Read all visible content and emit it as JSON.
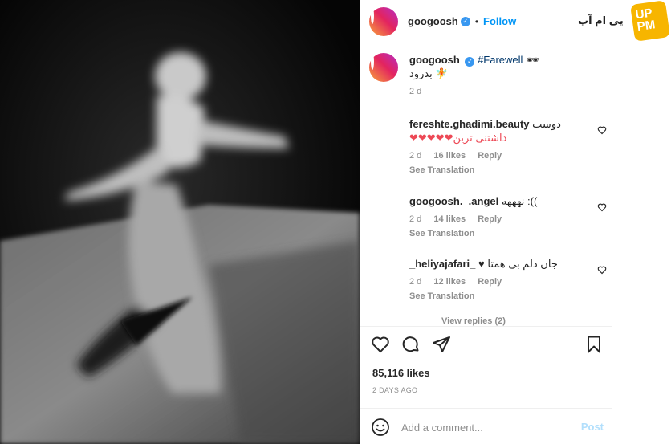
{
  "post": {
    "author": "googoosh",
    "follow_label": "Follow",
    "dot": "•",
    "caption_tag": "#Farewell",
    "caption_emoji": "🕶",
    "caption_line2": "بدرود 🧚",
    "caption_time": "2 d"
  },
  "comments": [
    {
      "username": "fereshte.ghadimi.beauty",
      "text_line1": "دوست",
      "text_line2": "❤❤❤❤❤داشتنی ترین",
      "time": "2 d",
      "likes": "16 likes",
      "reply": "Reply",
      "translation": "See Translation"
    },
    {
      "username": "googoosh._.angel",
      "text_line1": "نهههه :((",
      "time": "2 d",
      "likes": "14 likes",
      "reply": "Reply",
      "translation": "See Translation"
    },
    {
      "username": "_heliyajafari_",
      "text_line1": "♥ جان دلم بی همتا",
      "time": "2 d",
      "likes": "12 likes",
      "reply": "Reply",
      "translation": "See Translation"
    }
  ],
  "view_replies": "View replies (2)",
  "likes_count": "85,116 likes",
  "posted_ago": "2 DAYS AGO",
  "add_comment": {
    "placeholder": "Add a comment...",
    "post_label": "Post"
  },
  "watermark": {
    "text": "پی ام آپ",
    "badge": "UP PM"
  },
  "colors": {
    "accent": "#0095f6",
    "verified": "#3897f0",
    "heart_red": "#ed4956",
    "muted": "#8e8e8e",
    "badge": "#f7b500"
  },
  "icons": [
    "like-icon",
    "comment-icon",
    "share-icon",
    "save-icon",
    "emoji-icon",
    "verified-icon",
    "heart-icon"
  ]
}
